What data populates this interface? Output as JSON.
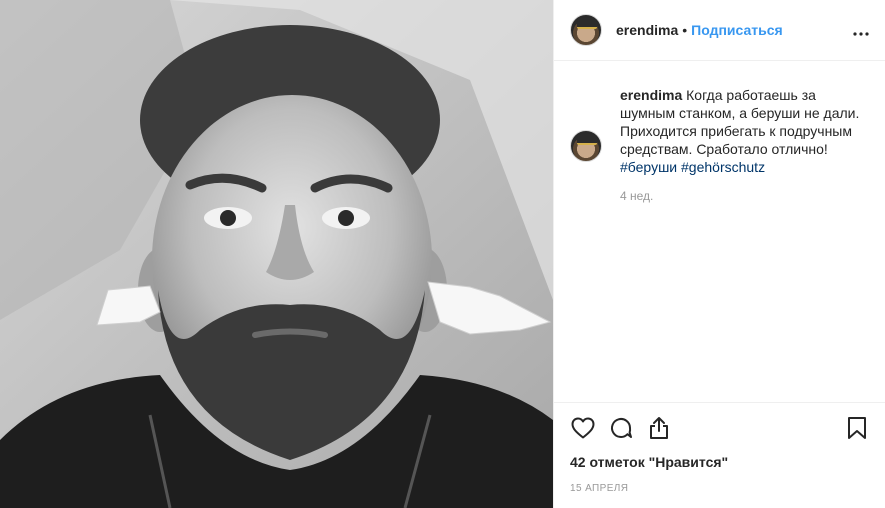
{
  "post": {
    "username": "erendima",
    "separator": "•",
    "follow_label": "Подписаться",
    "more_icon": "more-horizontal-icon"
  },
  "caption": {
    "username": "erendima",
    "text": "Когда работаешь за шумным станком, а беруши не дали. Приходится прибегать к подручным средствам. Сработало отлично!",
    "hashtags": [
      "#беруши",
      "#gehörschutz"
    ],
    "time_ago": "4 нед."
  },
  "actions": {
    "icons": [
      "heart-icon",
      "comment-icon",
      "share-icon",
      "bookmark-icon"
    ]
  },
  "likes": "42 отметок \"Нравится\"",
  "date": "15 АПРЕЛЯ",
  "colors": {
    "link": "#3897f0",
    "hashtag": "#003569",
    "muted": "#999999",
    "border": "#efefef"
  }
}
